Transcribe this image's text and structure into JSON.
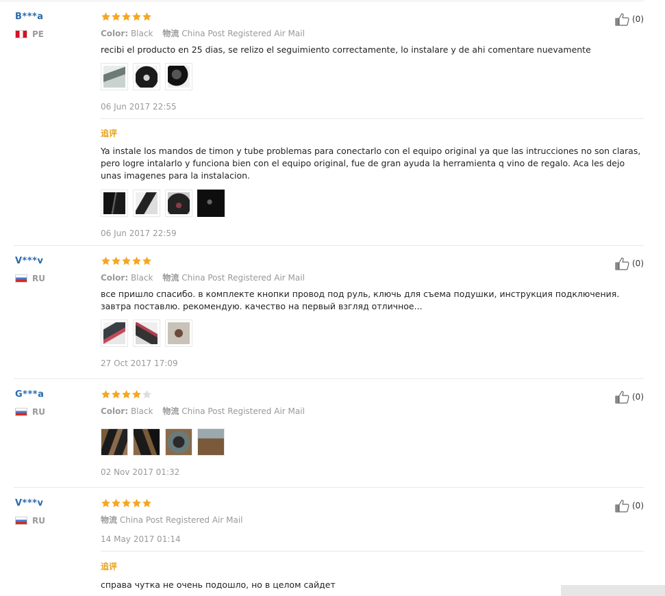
{
  "reviews": [
    {
      "user": "B***a",
      "country": "PE",
      "rating": 5,
      "color_label": "Color:",
      "color_value": "Black",
      "shipping_label": "物流",
      "shipping_value": "China Post Registered Air Mail",
      "text": "recibi el producto en 25 dias, se relizo el seguimiento correctamente, lo instalare y de ahi comentare nuevamente",
      "date": "06 Jun 2017 22:55",
      "likes": "(0)",
      "followup_label": "追评",
      "followup_text": "Ya instale los mandos de timon y tube problemas para conectarlo con el equipo original ya que las intrucciones no son claras, pero logre intalarlo y funciona bien con el equipo original, fue de gran ayuda la herramienta q vino de regalo. Aca les dejo unas imagenes para la instalacion.",
      "followup_date": "06 Jun 2017 22:59"
    },
    {
      "user": "V***v",
      "country": "RU",
      "rating": 5,
      "color_label": "Color:",
      "color_value": "Black",
      "shipping_label": "物流",
      "shipping_value": "China Post Registered Air Mail",
      "text": "все пришло спасибо. в комплекте кнопки провод под руль, ключь для съема подушки, инструкция подключения. завтра поставлю. рекомендую. качество на первый взгляд отличное...",
      "date": "27 Oct 2017 17:09",
      "likes": "(0)"
    },
    {
      "user": "G***a",
      "country": "RU",
      "rating": 4,
      "color_label": "Color:",
      "color_value": "Black",
      "shipping_label": "物流",
      "shipping_value": "China Post Registered Air Mail",
      "date": "02 Nov 2017 01:32",
      "likes": "(0)"
    },
    {
      "user": "V***v",
      "country": "RU",
      "rating": 5,
      "shipping_label": "物流",
      "shipping_value": "China Post Registered Air Mail",
      "date": "14 May 2017 01:14",
      "likes": "(0)",
      "followup_label": "追评",
      "followup_text": "справа чутка не очень подошло, но в целом сайдет"
    }
  ],
  "colors": {
    "star_on": "#f5a623",
    "star_off": "#dddddd",
    "username": "#2b6aad",
    "followup": "#e5a019"
  },
  "icons": {
    "like": "thumbs-up-icon",
    "star": "star-icon"
  }
}
